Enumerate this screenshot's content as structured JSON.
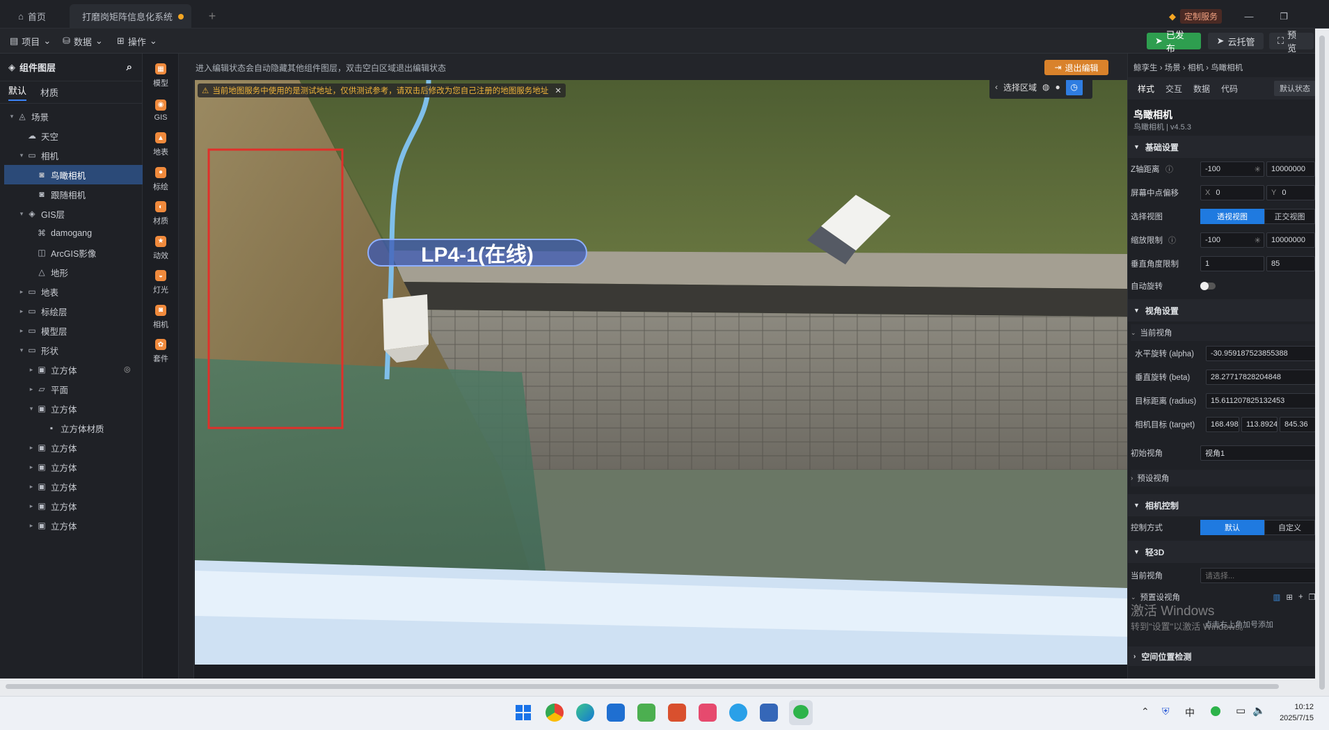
{
  "tabs": {
    "home": "首页",
    "doc": "打磨岗矩阵信息化系统"
  },
  "window": {
    "custom_service": "定制服务"
  },
  "toolbar": {
    "project": "项目",
    "data": "数据",
    "operate": "操作",
    "published": "已发布",
    "cloud": "云托管",
    "preview": "预览"
  },
  "editbar": {
    "tip": "进入编辑状态会自动隐藏其他组件图层，双击空白区域退出编辑状态",
    "exit": "退出编辑"
  },
  "left": {
    "title": "组件图层",
    "tab_default": "默认",
    "tab_material": "材质",
    "tree": [
      {
        "label": "场景",
        "icon": "scene-icon",
        "expand": "▾",
        "indent": 0,
        "selected": false
      },
      {
        "label": "天空",
        "icon": "sky-icon",
        "expand": "",
        "indent": 1,
        "selected": false
      },
      {
        "label": "相机",
        "icon": "folder-icon",
        "expand": "▾",
        "indent": 1,
        "selected": false
      },
      {
        "label": "鸟瞰相机",
        "icon": "camera-icon",
        "expand": "",
        "indent": 2,
        "selected": true
      },
      {
        "label": "跟随相机",
        "icon": "camera-icon",
        "expand": "",
        "indent": 2,
        "selected": false
      },
      {
        "label": "GIS层",
        "icon": "gis-icon",
        "expand": "▾",
        "indent": 1,
        "selected": false
      },
      {
        "label": "damogang",
        "icon": "network-icon",
        "expand": "",
        "indent": 2,
        "selected": false
      },
      {
        "label": "ArcGIS影像",
        "icon": "image-icon",
        "expand": "",
        "indent": 2,
        "selected": false
      },
      {
        "label": "地形",
        "icon": "terrain-icon",
        "expand": "",
        "indent": 2,
        "selected": false
      },
      {
        "label": "地表",
        "icon": "folder-icon",
        "expand": "▸",
        "indent": 1,
        "selected": false
      },
      {
        "label": "标绘层",
        "icon": "folder-icon",
        "expand": "▸",
        "indent": 1,
        "selected": false
      },
      {
        "label": "模型层",
        "icon": "folder-icon",
        "expand": "▸",
        "indent": 1,
        "selected": false
      },
      {
        "label": "形状",
        "icon": "folder-icon",
        "expand": "▾",
        "indent": 1,
        "selected": false
      },
      {
        "label": "立方体",
        "icon": "cube-icon",
        "expand": "▸",
        "indent": 2,
        "selected": false
      },
      {
        "label": "平面",
        "icon": "plane-icon",
        "expand": "▸",
        "indent": 2,
        "selected": false
      },
      {
        "label": "立方体",
        "icon": "cube-icon",
        "expand": "▾",
        "indent": 2,
        "selected": false
      },
      {
        "label": "立方体材质",
        "icon": "material-icon",
        "expand": "",
        "indent": 3,
        "selected": false
      },
      {
        "label": "立方体",
        "icon": "cube-icon",
        "expand": "▸",
        "indent": 2,
        "selected": false
      },
      {
        "label": "立方体",
        "icon": "cube-icon",
        "expand": "▸",
        "indent": 2,
        "selected": false
      },
      {
        "label": "立方体",
        "icon": "cube-icon",
        "expand": "▸",
        "indent": 2,
        "selected": false
      },
      {
        "label": "立方体",
        "icon": "cube-icon",
        "expand": "▸",
        "indent": 2,
        "selected": false
      },
      {
        "label": "立方体",
        "icon": "cube-icon",
        "expand": "▸",
        "indent": 2,
        "selected": false
      }
    ]
  },
  "iconbar": [
    {
      "label": "模型",
      "icon": "model-icon",
      "glyph": "▦"
    },
    {
      "label": "GIS",
      "icon": "gis-icon",
      "glyph": "◉"
    },
    {
      "label": "地表",
      "icon": "surface-icon",
      "glyph": "▲"
    },
    {
      "label": "标绘",
      "icon": "marker-icon",
      "glyph": "●"
    },
    {
      "label": "材质",
      "icon": "material-icon",
      "glyph": "◐"
    },
    {
      "label": "动效",
      "icon": "effect-icon",
      "glyph": "★"
    },
    {
      "label": "灯光",
      "icon": "light-icon",
      "glyph": "◒"
    },
    {
      "label": "相机",
      "icon": "camera-icon",
      "glyph": "◙"
    },
    {
      "label": "套件",
      "icon": "kit-icon",
      "glyph": "✿"
    }
  ],
  "map": {
    "warning": "当前地图服务中使用的是测试地址，仅供测试参考，请双击后修改为您自己注册的地图服务地址",
    "select_area": "选择区域",
    "label": "LP4-1(在线)"
  },
  "right": {
    "breadcrumb": "鲸孪生 › 场景 › 相机 › 鸟瞰相机",
    "tab_style": "样式",
    "tab_interact": "交互",
    "tab_data": "数据",
    "tab_code": "代码",
    "state": "默认状态",
    "name": "鸟瞰相机",
    "version": "鸟瞰相机 | v4.5.3",
    "sec_basic": "基础设置",
    "z_label": "Z轴距离",
    "z_min": "-100",
    "z_max": "10000000",
    "offset_label": "屏幕中点偏移",
    "offset_x_tag": "X",
    "offset_x": "0",
    "offset_y_tag": "Y",
    "offset_y": "0",
    "view_label": "选择视图",
    "view_persp": "透视视图",
    "view_ortho": "正交视图",
    "zoom_label": "缩放限制",
    "zoom_min": "-100",
    "zoom_max": "10000000",
    "vangle_label": "垂直角度限制",
    "vangle_min": "1",
    "vangle_max": "85",
    "autorotate_label": "自动旋转",
    "sec_view": "视角设置",
    "current_view": "当前视角",
    "alpha_label": "水平旋转 (alpha)",
    "alpha": "-30.959187523855388",
    "beta_label": "垂直旋转 (beta)",
    "beta": "28.27717828204848",
    "radius_label": "目标距离 (radius)",
    "radius": "15.611207825132453",
    "target_label": "相机目标 (target)",
    "target_x": "168.4984",
    "target_y": "113.89241",
    "target_z": "845.36",
    "init_view_label": "初始视角",
    "init_view": "视角1",
    "preset_view": "预设视角",
    "sec_control": "相机控制",
    "control_label": "控制方式",
    "control_default": "默认",
    "control_custom": "自定义",
    "sec_light3d": "轻3D",
    "cur_view_label": "当前视角",
    "cur_view_placeholder": "请选择...",
    "preset_views": "预置设视角",
    "sec_space": "空间位置检测",
    "watermark1": "激活 Windows",
    "watermark2": "转到\"设置\"以激活 Windows。",
    "add_hint": "点击右上角加号添加"
  },
  "clock": {
    "time": "10:12",
    "date": "2025/7/15"
  },
  "ime": "中"
}
